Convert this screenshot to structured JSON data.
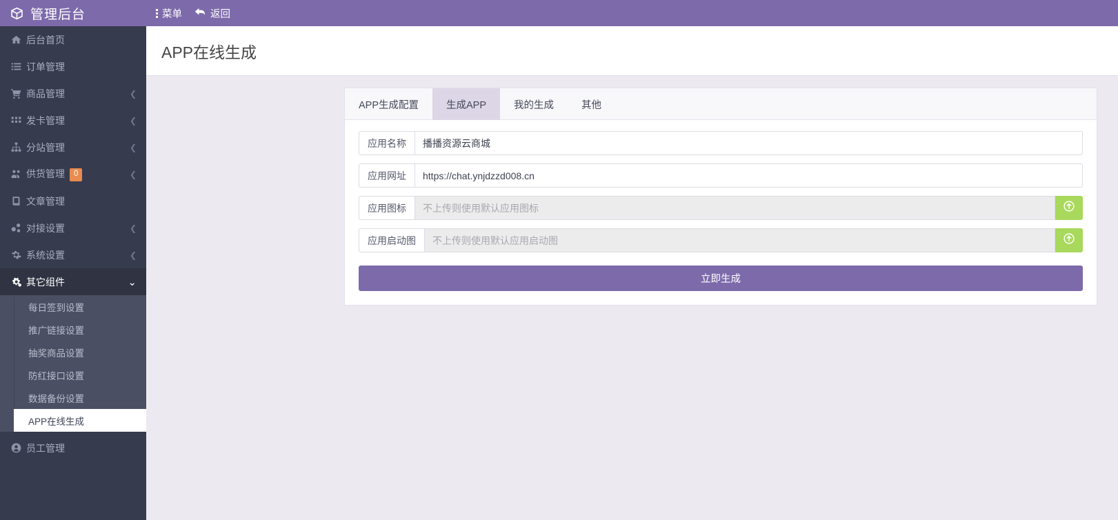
{
  "topbar": {
    "brand": "管理后台",
    "brand_icon": "cube-icon",
    "nav": [
      {
        "label": "菜单",
        "icon": "vertical-dots-icon"
      },
      {
        "label": "返回",
        "icon": "back-arrow-icon"
      }
    ]
  },
  "sidebar": {
    "items": [
      {
        "label": "后台首页",
        "icon": "home-icon",
        "caret": "",
        "badge": ""
      },
      {
        "label": "订单管理",
        "icon": "list-icon",
        "caret": "",
        "badge": ""
      },
      {
        "label": "商品管理",
        "icon": "cart-icon",
        "caret": "❮",
        "badge": ""
      },
      {
        "label": "发卡管理",
        "icon": "grid-icon",
        "caret": "❮",
        "badge": ""
      },
      {
        "label": "分站管理",
        "icon": "sitemap-icon",
        "caret": "❮",
        "badge": ""
      },
      {
        "label": "供货管理",
        "icon": "users-icon",
        "caret": "❮",
        "badge": "0"
      },
      {
        "label": "文章管理",
        "icon": "book-icon",
        "caret": "",
        "badge": ""
      },
      {
        "label": "对接设置",
        "icon": "nodes-icon",
        "caret": "❮",
        "badge": ""
      },
      {
        "label": "系统设置",
        "icon": "gear-icon",
        "caret": "❮",
        "badge": ""
      }
    ],
    "group": {
      "label": "其它组件",
      "icon": "cogs-icon",
      "caret": "⌄"
    },
    "submenu": [
      {
        "label": "每日签到设置",
        "active": false
      },
      {
        "label": "推广链接设置",
        "active": false
      },
      {
        "label": "抽奖商品设置",
        "active": false
      },
      {
        "label": "防红接口设置",
        "active": false
      },
      {
        "label": "数据备份设置",
        "active": false
      },
      {
        "label": "APP在线生成",
        "active": true
      }
    ],
    "after": [
      {
        "label": "员工管理",
        "icon": "user-circle-icon",
        "caret": "",
        "badge": ""
      }
    ]
  },
  "page": {
    "title": "APP在线生成"
  },
  "tabs": [
    {
      "label": "APP生成配置",
      "active": false
    },
    {
      "label": "生成APP",
      "active": true
    },
    {
      "label": "我的生成",
      "active": false
    },
    {
      "label": "其他",
      "active": false
    }
  ],
  "form": {
    "fields": [
      {
        "label": "应用名称",
        "value": "播播资源云商城",
        "placeholder": "",
        "disabled": false,
        "upload": false
      },
      {
        "label": "应用网址",
        "value": "https://chat.ynjdzzd008.cn",
        "placeholder": "",
        "disabled": false,
        "upload": false
      },
      {
        "label": "应用图标",
        "value": "",
        "placeholder": "不上传则使用默认应用图标",
        "disabled": true,
        "upload": true,
        "upload_icon": "upload-circle-icon"
      },
      {
        "label": "应用启动图",
        "value": "",
        "placeholder": "不上传则使用默认应用启动图",
        "disabled": true,
        "upload": true,
        "upload_icon": "upload-circle-icon"
      }
    ],
    "submit_label": "立即生成"
  },
  "colors": {
    "brand_purple": "#7d6aab",
    "sidebar_dark": "#363b4d",
    "submenu_slate": "#4a4f63",
    "content_bg": "#ece9f1",
    "tab_active": "#ddd6e6",
    "upload_green": "#a8d85c",
    "badge_orange": "#e98b4e"
  }
}
